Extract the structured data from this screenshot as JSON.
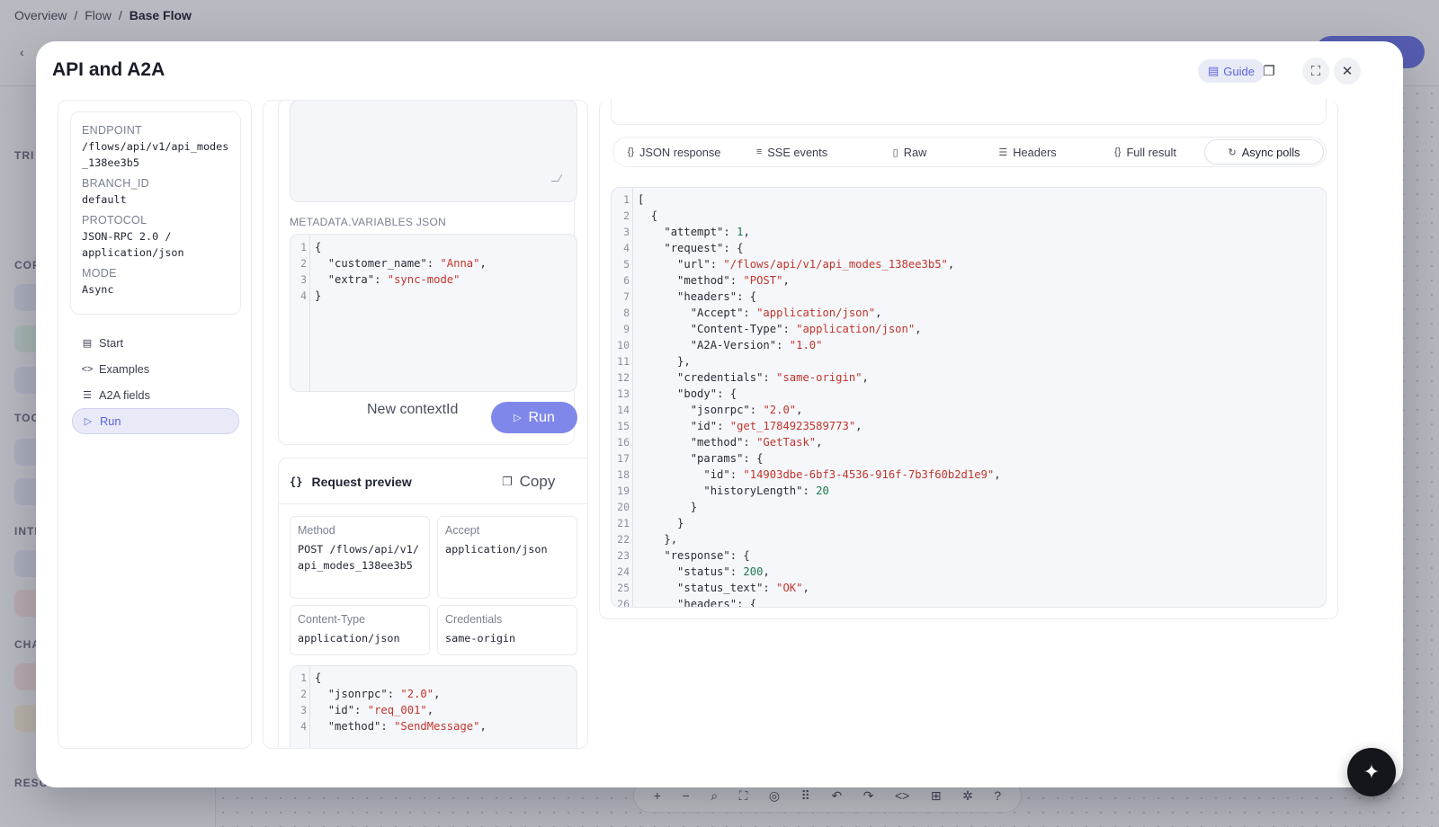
{
  "breadcrumb": {
    "items": [
      "Overview",
      "Flow",
      "Base Flow"
    ]
  },
  "background": {
    "sections": [
      "TRI",
      "COF",
      "TOO",
      "INTI",
      "CHA",
      "RESOURCES"
    ],
    "resources_help": "?"
  },
  "modal": {
    "title": "API and A2A",
    "guide_label": "Guide"
  },
  "info": {
    "endpoint_label": "ENDPOINT",
    "endpoint_value": "/flows/api/v1/api_modes_138ee3b5",
    "branch_label": "BRANCH_ID",
    "branch_value": "default",
    "protocol_label": "PROTOCOL",
    "protocol_value_1": "JSON-RPC 2.0 /",
    "protocol_value_2": "application/json",
    "mode_label": "MODE",
    "mode_value": "Async"
  },
  "nav": {
    "items": [
      {
        "label": "Start",
        "icon": "book-icon"
      },
      {
        "label": "Examples",
        "icon": "code-icon"
      },
      {
        "label": "A2A fields",
        "icon": "list-icon"
      },
      {
        "label": "Run",
        "icon": "play-icon"
      }
    ]
  },
  "metadata": {
    "label": "METADATA.VARIABLES JSON",
    "lines": [
      {
        "n": "1",
        "code": "{"
      },
      {
        "n": "2",
        "indent": "  ",
        "key": "\"customer_name\"",
        "sep": ": ",
        "str": "\"Anna\"",
        "tail": ","
      },
      {
        "n": "3",
        "indent": "  ",
        "key": "\"extra\"",
        "sep": ": ",
        "str": "\"sync-mode\""
      },
      {
        "n": "4",
        "code": "}"
      }
    ]
  },
  "actions": {
    "new_context": "New contextId",
    "run": "Run"
  },
  "request_preview": {
    "title": "Request preview",
    "copy": "Copy",
    "method_label": "Method",
    "method_value": "POST /flows/api/v1/api_modes_138ee3b5",
    "accept_label": "Accept",
    "accept_value": "application/json",
    "content_type_label": "Content-Type",
    "content_type_value": "application/json",
    "credentials_label": "Credentials",
    "credentials_value": "same-origin",
    "lines": [
      {
        "n": "1",
        "code": "{"
      },
      {
        "n": "2",
        "indent": "  ",
        "key": "\"jsonrpc\"",
        "sep": ": ",
        "str": "\"2.0\"",
        "tail": ","
      },
      {
        "n": "3",
        "indent": "  ",
        "key": "\"id\"",
        "sep": ": ",
        "str": "\"req_001\"",
        "tail": ","
      },
      {
        "n": "4",
        "indent": "  ",
        "key": "\"method\"",
        "sep": ": ",
        "str": "\"SendMessage\"",
        "tail": ","
      }
    ]
  },
  "tabs": [
    {
      "label": "JSON response",
      "icon": "braces-icon",
      "glyph": "{}"
    },
    {
      "label": "SSE events",
      "icon": "stream-icon",
      "glyph": "≡"
    },
    {
      "label": "Raw",
      "icon": "file-icon",
      "glyph": "▯"
    },
    {
      "label": "Headers",
      "icon": "list-icon",
      "glyph": "☰"
    },
    {
      "label": "Full result",
      "icon": "braces-icon",
      "glyph": "{}"
    },
    {
      "label": "Async polls",
      "icon": "refresh-icon",
      "glyph": "↻",
      "active": true
    }
  ],
  "response": {
    "lines": [
      {
        "n": "1",
        "code": "["
      },
      {
        "n": "2",
        "indent": "  ",
        "code": "{"
      },
      {
        "n": "3",
        "indent": "    ",
        "key": "\"attempt\"",
        "sep": ": ",
        "num": "1",
        "tail": ","
      },
      {
        "n": "4",
        "indent": "    ",
        "key": "\"request\"",
        "sep": ": ",
        "tail": "{"
      },
      {
        "n": "5",
        "indent": "      ",
        "key": "\"url\"",
        "sep": ": ",
        "str": "\"/flows/api/v1/api_modes_138ee3b5\"",
        "tail": ","
      },
      {
        "n": "6",
        "indent": "      ",
        "key": "\"method\"",
        "sep": ": ",
        "str": "\"POST\"",
        "tail": ","
      },
      {
        "n": "7",
        "indent": "      ",
        "key": "\"headers\"",
        "sep": ": ",
        "tail": "{"
      },
      {
        "n": "8",
        "indent": "        ",
        "key": "\"Accept\"",
        "sep": ": ",
        "str": "\"application/json\"",
        "tail": ","
      },
      {
        "n": "9",
        "indent": "        ",
        "key": "\"Content-Type\"",
        "sep": ": ",
        "str": "\"application/json\"",
        "tail": ","
      },
      {
        "n": "10",
        "indent": "        ",
        "key": "\"A2A-Version\"",
        "sep": ": ",
        "str": "\"1.0\""
      },
      {
        "n": "11",
        "indent": "      ",
        "code": "},"
      },
      {
        "n": "12",
        "indent": "      ",
        "key": "\"credentials\"",
        "sep": ": ",
        "str": "\"same-origin\"",
        "tail": ","
      },
      {
        "n": "13",
        "indent": "      ",
        "key": "\"body\"",
        "sep": ": ",
        "tail": "{"
      },
      {
        "n": "14",
        "indent": "        ",
        "key": "\"jsonrpc\"",
        "sep": ": ",
        "str": "\"2.0\"",
        "tail": ","
      },
      {
        "n": "15",
        "indent": "        ",
        "key": "\"id\"",
        "sep": ": ",
        "str": "\"get_1784923589773\"",
        "tail": ","
      },
      {
        "n": "16",
        "indent": "        ",
        "key": "\"method\"",
        "sep": ": ",
        "str": "\"GetTask\"",
        "tail": ","
      },
      {
        "n": "17",
        "indent": "        ",
        "key": "\"params\"",
        "sep": ": ",
        "tail": "{"
      },
      {
        "n": "18",
        "indent": "          ",
        "key": "\"id\"",
        "sep": ": ",
        "str": "\"14903dbe-6bf3-4536-916f-7b3f60b2d1e9\"",
        "tail": ","
      },
      {
        "n": "19",
        "indent": "          ",
        "key": "\"historyLength\"",
        "sep": ": ",
        "num": "20"
      },
      {
        "n": "20",
        "indent": "        ",
        "code": "}"
      },
      {
        "n": "21",
        "indent": "      ",
        "code": "}"
      },
      {
        "n": "22",
        "indent": "    ",
        "code": "},"
      },
      {
        "n": "23",
        "indent": "    ",
        "key": "\"response\"",
        "sep": ": ",
        "tail": "{"
      },
      {
        "n": "24",
        "indent": "      ",
        "key": "\"status\"",
        "sep": ": ",
        "num": "200",
        "tail": ","
      },
      {
        "n": "25",
        "indent": "      ",
        "key": "\"status_text\"",
        "sep": ": ",
        "str": "\"OK\"",
        "tail": ","
      },
      {
        "n": "26",
        "indent": "      ",
        "key": "\"headers\"",
        "sep": ": ",
        "tail": "{"
      }
    ]
  },
  "toolbar": {
    "glyphs": [
      "+",
      "−",
      "⌕",
      "⛶",
      "◎",
      "⠿",
      "↶",
      "↷",
      "<>",
      "⊞",
      "✲",
      "?"
    ]
  }
}
